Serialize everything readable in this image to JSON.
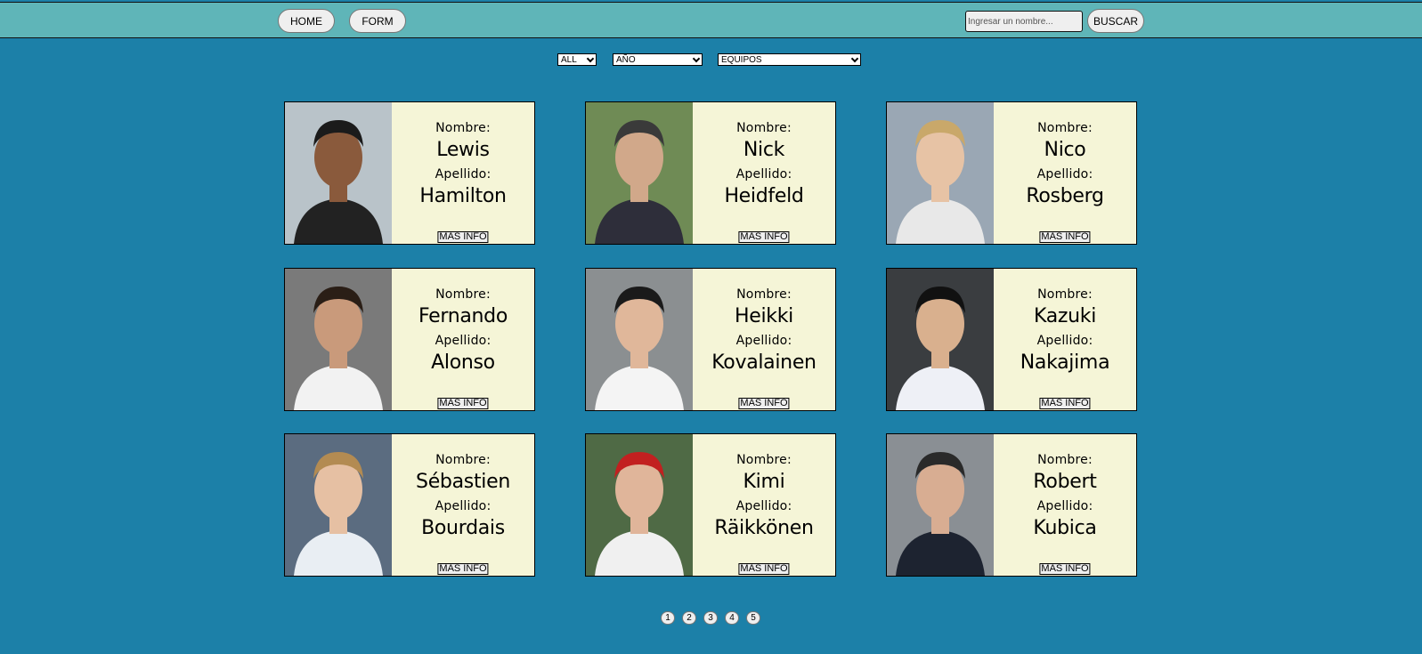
{
  "nav": {
    "home_label": "HOME",
    "form_label": "FORM",
    "search_placeholder": "Ingresar un nombre...",
    "search_button_label": "BUSCAR"
  },
  "filters": {
    "order_selected": "ALL",
    "year_selected": "AÑO",
    "teams_selected": "EQUIPOS"
  },
  "card_labels": {
    "first_name_label": "Nombre:",
    "last_name_label": "Apellido:",
    "more_info_label": "MAS INFO"
  },
  "drivers": [
    {
      "first_name": "Lewis",
      "last_name": "Hamilton"
    },
    {
      "first_name": "Nick",
      "last_name": "Heidfeld"
    },
    {
      "first_name": "Nico",
      "last_name": "Rosberg"
    },
    {
      "first_name": "Fernando",
      "last_name": "Alonso"
    },
    {
      "first_name": "Heikki",
      "last_name": "Kovalainen"
    },
    {
      "first_name": "Kazuki",
      "last_name": "Nakajima"
    },
    {
      "first_name": "Sébastien",
      "last_name": "Bourdais"
    },
    {
      "first_name": "Kimi",
      "last_name": "Räikkönen"
    },
    {
      "first_name": "Robert",
      "last_name": "Kubica"
    }
  ],
  "pagination": [
    "1",
    "2",
    "3",
    "4",
    "5"
  ],
  "colors": {
    "background": "#1c80a8",
    "navbar": "#5fb5b8",
    "card": "#f5f5d7"
  }
}
